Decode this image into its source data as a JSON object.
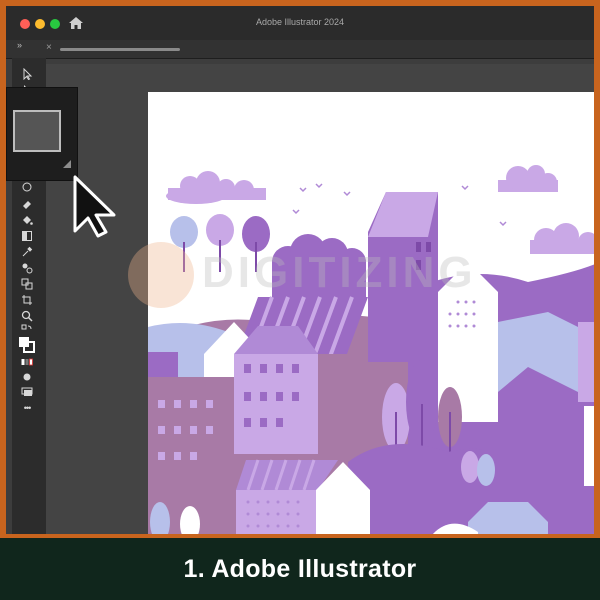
{
  "window": {
    "title": "Adobe Illustrator 2024",
    "tab_close": "×",
    "panel_toggle": "»"
  },
  "toolbar": {
    "tools": [
      "selection-tool",
      "direct-selection-tool",
      "pen-tool",
      "type-tool",
      "rectangle-tool",
      "rotate-tool",
      "eraser-tool",
      "paint-bucket-tool",
      "gradient-tool",
      "eyedropper-tool",
      "blend-tool",
      "shape-builder-tool",
      "artboard-tool",
      "zoom-tool",
      "swap-colors",
      "fill-stroke-swatch",
      "color-mode",
      "draw-mode",
      "screen-mode",
      "more-tools"
    ],
    "more_label": "•••"
  },
  "artwork": {
    "palette": {
      "light_purple": "#c9a8e6",
      "mid_purple": "#9b6bc4",
      "dark_purple": "#7d4aa8",
      "mauve": "#a87aa6",
      "periwinkle": "#b7c0ea",
      "white": "#ffffff"
    }
  },
  "watermark": {
    "text": "DIGITIZING"
  },
  "caption": {
    "text": "1. Adobe Illustrator",
    "background": "#10261c"
  },
  "colors": {
    "frame_border": "#c8641e",
    "app_chrome": "#2b2b2b"
  }
}
